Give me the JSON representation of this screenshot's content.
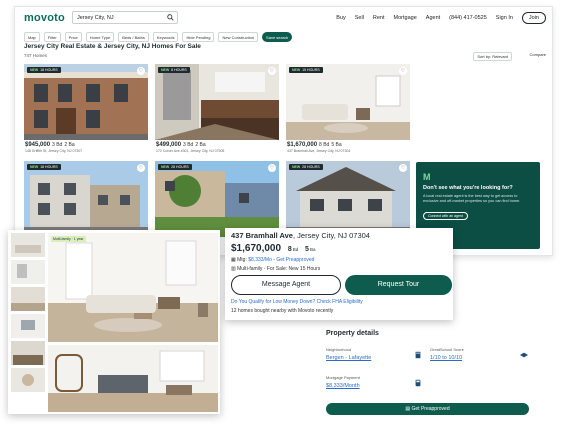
{
  "header": {
    "logo": "movoto",
    "search_value": "Jersey City, NJ",
    "nav": [
      "Buy",
      "Sell",
      "Rent",
      "Mortgage",
      "Agent",
      "(844) 417-0525",
      "Sign In"
    ],
    "join_label": "Join"
  },
  "filters": [
    "Map",
    "Filter",
    "Price",
    "Home Type",
    "Beds / Baths",
    "Keywords",
    "Hide Pending",
    "New Construction",
    "Save search"
  ],
  "page": {
    "title": "Jersey City Real Estate & Jersey City, NJ Homes For Sale",
    "count": "747 Homes",
    "sort": "Sort by: Relevant",
    "compare": "Compare"
  },
  "cards": [
    {
      "badge": "18 HOURS",
      "price": "$945,000",
      "beds": "3 Bd",
      "baths": "2 Ba",
      "address": "148 Griffith St, Jersey City, NJ 07307"
    },
    {
      "badge": "8 HOURS",
      "price": "$499,000",
      "beds": "3 Bd",
      "baths": "2 Ba",
      "address": "172 Culver Ave #301, Jersey City, NJ 07305"
    },
    {
      "badge": "15 HOURS",
      "price": "$1,670,000",
      "beds": "8 Bd",
      "baths": "5 Ba",
      "address": "437 Bramhall Ave, Jersey City, NJ 07304"
    },
    {
      "badge": "18 HOURS",
      "price": "",
      "beds": "",
      "baths": "",
      "address": ""
    },
    {
      "badge": "28 HOURS",
      "price": "",
      "beds": "",
      "baths": "",
      "address": ""
    },
    {
      "badge": "28 HOURS",
      "price": "",
      "beds": "",
      "baths": "",
      "address": ""
    }
  ],
  "badge_prefix": "NEW",
  "promo": {
    "logo": "M",
    "heading": "Don't see what you're looking for?",
    "text": "A local real estate agent is the best way to get access to exclusive and off-market properties so you can find home.",
    "button": "Connect with an agent"
  },
  "gallery": {
    "tag": "Multi-family · 1 year"
  },
  "details": {
    "street": "437 Bramhall Ave",
    "city": "Jersey City, NJ 07304",
    "price": "$1,670,000",
    "beds_num": "8",
    "beds_unit": "Bd",
    "baths_num": "5",
    "baths_unit": "Ba",
    "mtg_label": "Mtg:",
    "mtg_value": "$8,333/Mo",
    "mtg_link": "Get Preapproved",
    "type": "Multi-family · For Sale: New 15 Hours",
    "message_agent": "Message Agent",
    "request_tour": "Request Tour",
    "fha": "Do You Qualify for Low Money Down? Check FHA Eligibility",
    "nearby": "12 homes bought nearby with Movoto recently"
  },
  "property_details": {
    "title": "Property details",
    "neighborhood_label": "Neighborhood",
    "neighborhood_value": "Bergen - Lafayette",
    "school_label": "GreatSchool Score",
    "school_value": "1/10 to 10/10",
    "payment_label": "Mortgage Payment",
    "payment_value": "$8,333/Month",
    "button": "Get Preapproved"
  },
  "colors": {
    "brand": "#0e6e5b",
    "button_dark": "#0e5c4d",
    "link": "#2a6ec7",
    "promo_bg": "#0c4e44"
  }
}
